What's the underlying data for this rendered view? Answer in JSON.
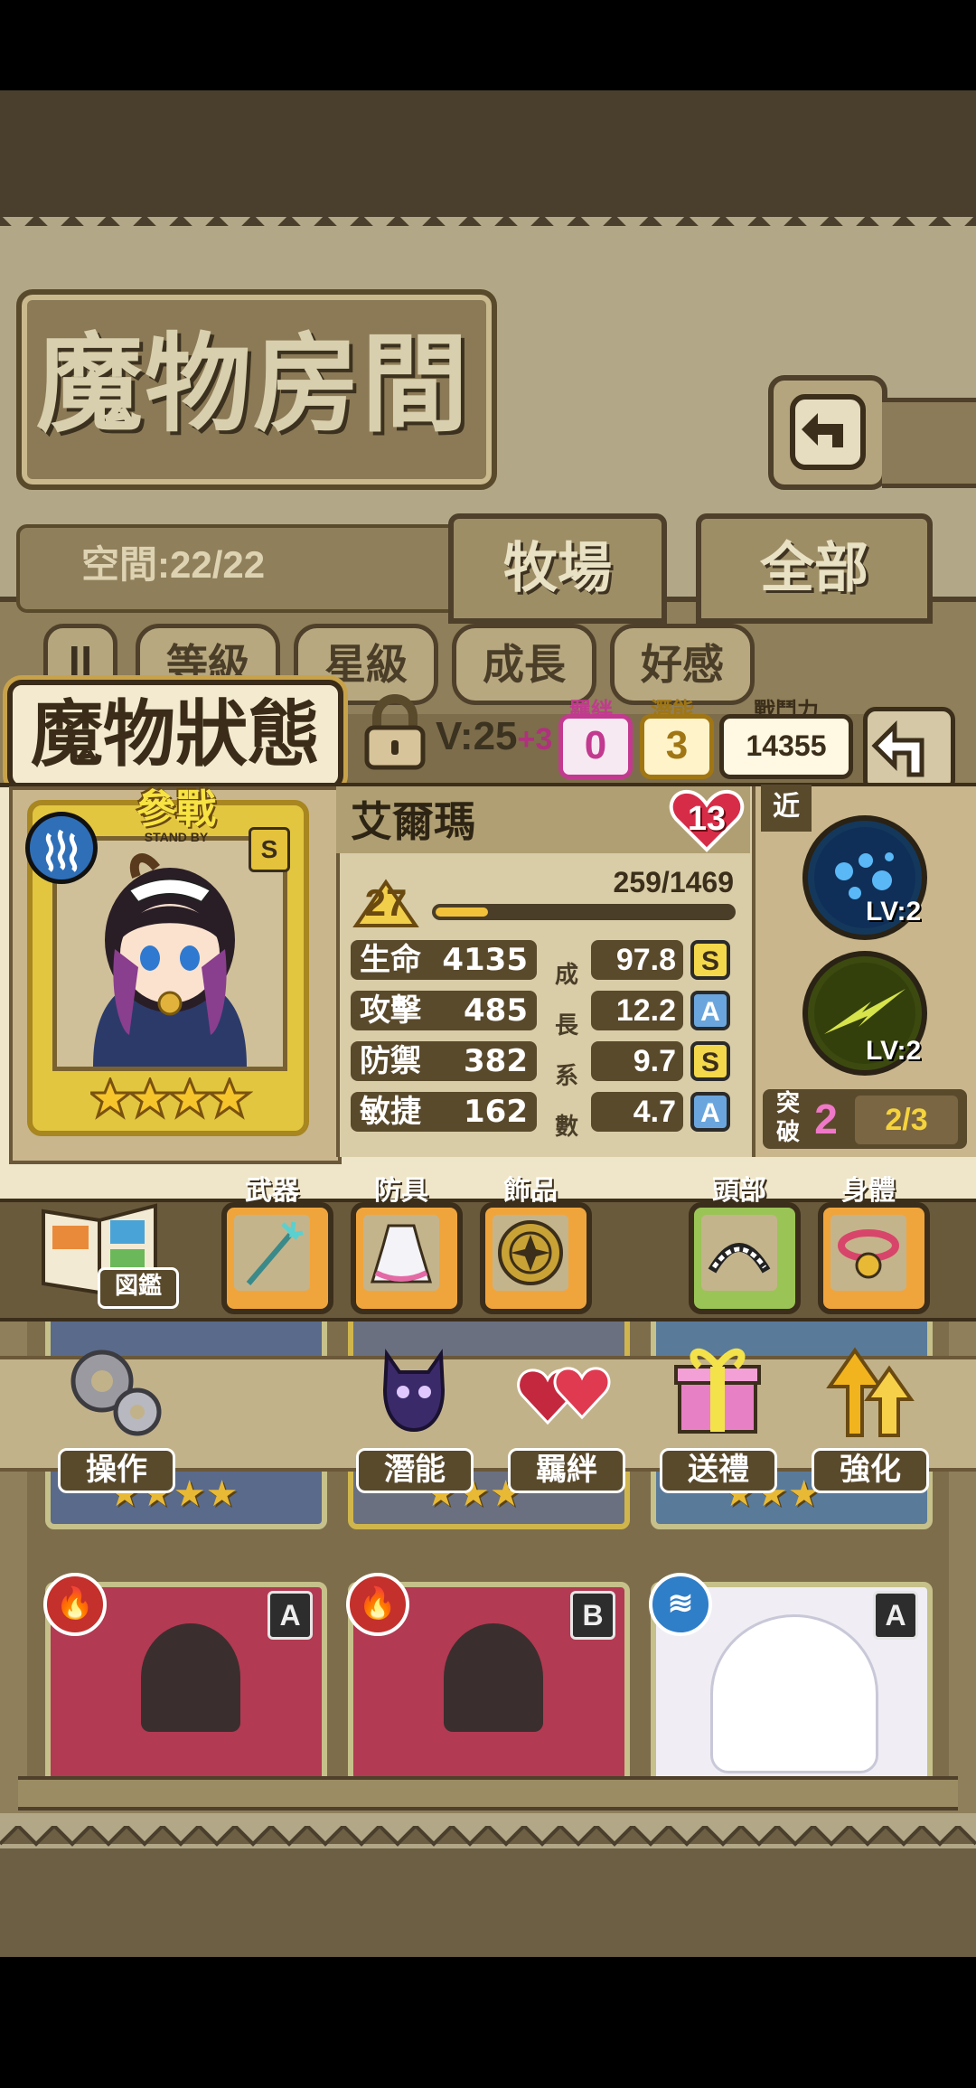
{
  "header": {
    "title": "魔物房間",
    "space_label": "空間:22/22",
    "tabs": [
      {
        "label": "牧場"
      },
      {
        "label": "全部"
      }
    ]
  },
  "sort_buttons": [
    {
      "label": "等級"
    },
    {
      "label": "星級"
    },
    {
      "label": "成長"
    },
    {
      "label": "好感"
    }
  ],
  "sort_toggle_icon": "pause-sort-icon",
  "status": {
    "title": "魔物狀態",
    "level_tag": "V:25",
    "level_plus": "+3",
    "bond_label": "羈絆",
    "bond_value": "0",
    "potential_label": "潛能",
    "potential_value": "3",
    "power_label": "戰鬥力",
    "power_value": "14355"
  },
  "monster": {
    "name": "艾爾瑪",
    "affection": "13",
    "battle_tag": "參戰",
    "standby": "STAND BY",
    "card_rank": "S",
    "element": "water",
    "stars": 4,
    "level": "27",
    "exp_text": "259/1469",
    "exp_ratio": 0.176,
    "stats": [
      {
        "label": "生命",
        "value": "4135",
        "growth": "97.8",
        "grade": "S"
      },
      {
        "label": "攻擊",
        "value": "485",
        "growth": "12.2",
        "grade": "A"
      },
      {
        "label": "防禦",
        "value": "382",
        "growth": "9.7",
        "grade": "S"
      },
      {
        "label": "敏捷",
        "value": "162",
        "growth": "4.7",
        "grade": "A"
      }
    ],
    "growth_vertical": [
      "成",
      "長",
      "系",
      "數"
    ],
    "range": "近",
    "skills": [
      {
        "level": "LV:2",
        "color": "#1f5b95"
      },
      {
        "level": "LV:2",
        "color": "#a7b51d"
      }
    ],
    "breakthrough_label": "突破",
    "breakthrough_value": "2",
    "breakthrough_frac": "2/3"
  },
  "equipment": {
    "book_label": "図鑑",
    "slots": [
      {
        "label": "武器",
        "icon": "trident-icon"
      },
      {
        "label": "防具",
        "icon": "maid-dress-icon"
      },
      {
        "label": "飾品",
        "icon": "gold-medallion-icon"
      },
      {
        "label": "頭部",
        "icon": "maid-headband-icon"
      },
      {
        "label": "身體",
        "icon": "bell-collar-icon"
      }
    ]
  },
  "actions": [
    {
      "label": "操作",
      "icon": "gears-icon"
    },
    {
      "label": "潛能",
      "icon": "shadow-demon-icon"
    },
    {
      "label": "羈絆",
      "icon": "hearts-icon"
    },
    {
      "label": "送禮",
      "icon": "gift-box-icon"
    },
    {
      "label": "強化",
      "icon": "up-arrows-icon"
    }
  ],
  "background_cards": [
    {
      "element": "fire",
      "rank": "A"
    },
    {
      "element": "fire",
      "rank": "B"
    },
    {
      "element": "water",
      "rank": "A"
    }
  ]
}
